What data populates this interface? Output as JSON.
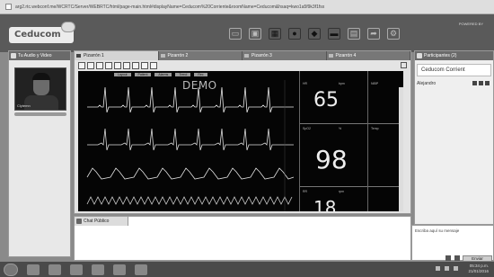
{
  "browser": {
    "url": "arg2.rtc.webconf.me/WCRTC/Server/WEBRTC/html/page-main.html#displayName=Ceducom%20Corriente&roomName=Ceducom&hsaq=kwo1a5f9k3f1fsx"
  },
  "header": {
    "logo": "Ceducom",
    "brand": "POWERED BY",
    "toolbar_icons": [
      "layout-icon",
      "screen-share-icon",
      "grid-icon",
      "users-icon",
      "group-icon",
      "chat-icon",
      "document-icon",
      "share-icon",
      "settings-icon"
    ]
  },
  "left_panel": {
    "title": "Tu Audio y Video",
    "camera_label": "Clytemn"
  },
  "whiteboard": {
    "tabs": [
      "Pizarrón 1",
      "Pizarrón 2",
      "Pizarrón 3",
      "Pizarrón 4"
    ],
    "active_tab": 0,
    "monitor": {
      "menu": [
        "Layout",
        "Patient",
        "Alarms",
        "Trend",
        "Rec"
      ],
      "watermark": "DEMO",
      "values": {
        "hr": "65",
        "spo2": "98",
        "resp": "18"
      },
      "labels": [
        "HR",
        "bpm",
        "SpO2",
        "%",
        "RR",
        "rpm",
        "NIBP",
        "Temp"
      ]
    }
  },
  "right_panel": {
    "title": "Participantes (2)",
    "current_user": "Ceducom Corrient",
    "participants": [
      "Alejandro"
    ]
  },
  "chat": {
    "tab": "Chat Público",
    "placeholder": "Escriba aquí su mensaje",
    "send_label": "Enviar"
  },
  "taskbar": {
    "time": "05:34 p.m.",
    "date": "21/01/2016"
  },
  "colors": {
    "header": "#5a5a5a",
    "panel_header": "#6a6a6a",
    "monitor_bg": "#050505"
  }
}
